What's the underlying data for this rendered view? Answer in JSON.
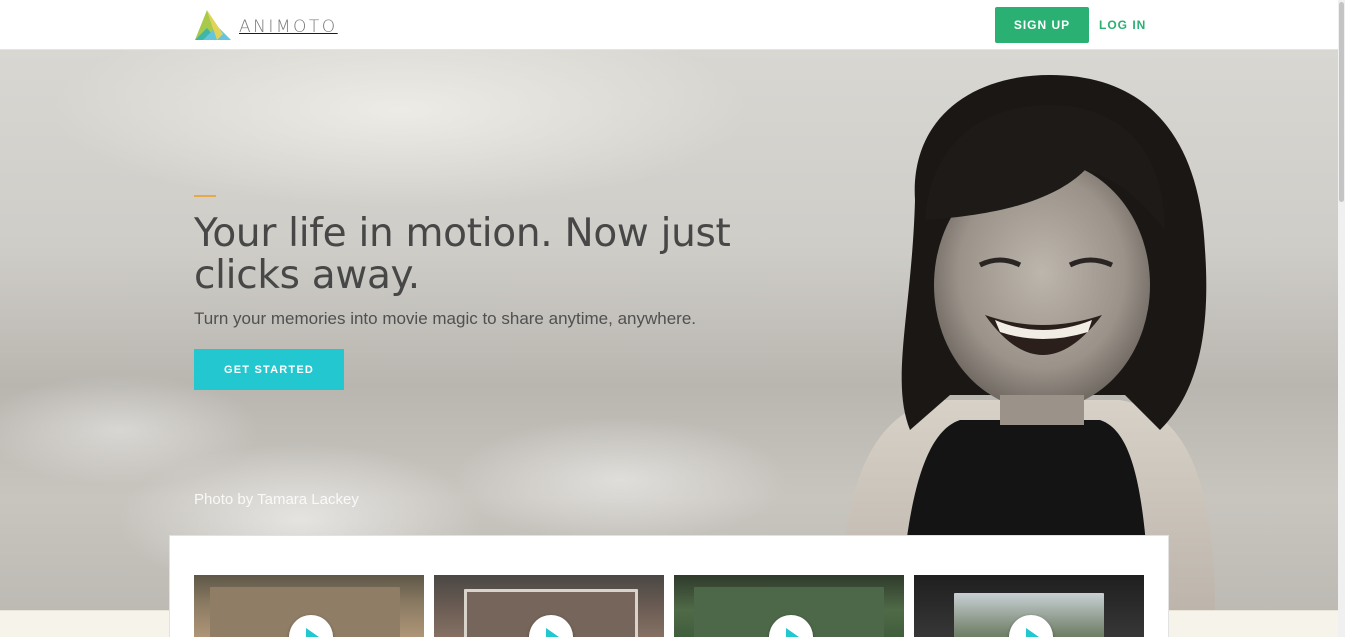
{
  "header": {
    "logo_text": "ANIMOTO",
    "signup_label": "SIGN UP",
    "login_label": "LOG IN"
  },
  "hero": {
    "headline": "Your life in motion. Now just clicks away.",
    "subheadline": "Turn your memories into movie magic to share anytime, anywhere.",
    "cta_label": "GET STARTED",
    "photo_credit": "Photo by Tamara Lackey"
  },
  "videos": [
    {
      "icon": "play-icon"
    },
    {
      "icon": "play-icon"
    },
    {
      "icon": "play-icon"
    },
    {
      "icon": "play-icon"
    }
  ],
  "colors": {
    "brand_green": "#2ab073",
    "cta_teal": "#23c7cf",
    "accent_orange": "#e8a84a",
    "headline_gray": "#474747"
  }
}
